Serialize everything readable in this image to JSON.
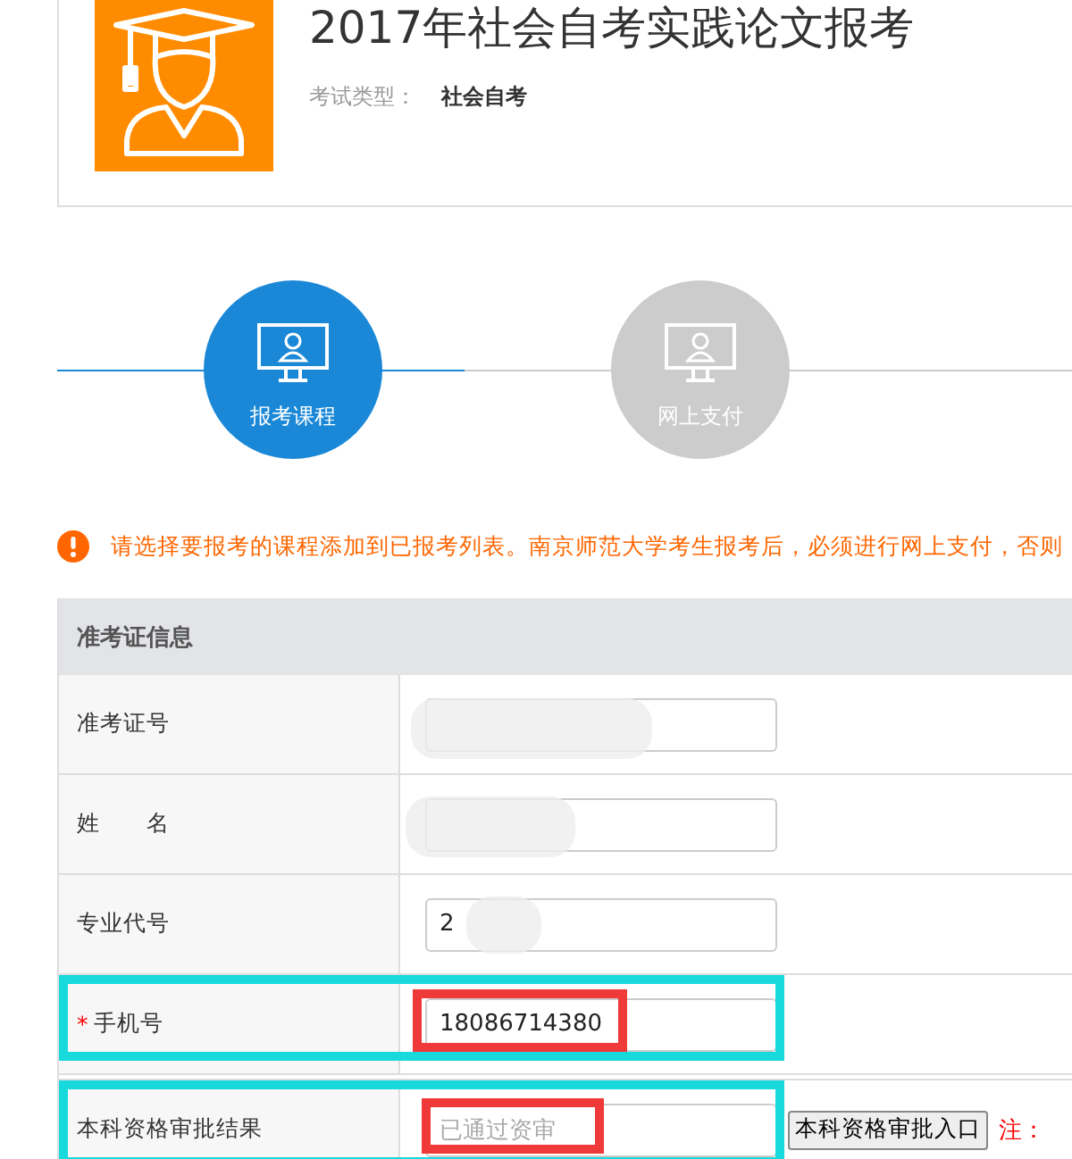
{
  "header": {
    "title": "2017年社会自考实践论文报考",
    "meta_label": "考试类型：",
    "meta_value": "社会自考"
  },
  "steps": [
    {
      "label": "报考课程",
      "selected": true
    },
    {
      "label": "网上支付",
      "selected": false
    }
  ],
  "notice": "请选择要报考的课程添加到已报考列表。南京师范大学考生报考后，必须进行网上支付，否则",
  "form": {
    "title": "准考证信息",
    "rows": [
      {
        "label": "准考证号",
        "redacted": true,
        "highlighted": false,
        "value_highlighted": false
      },
      {
        "label": "姓　　名",
        "redacted": true,
        "highlighted": false,
        "value_highlighted": false
      },
      {
        "label": "专业代号",
        "value": "2",
        "redacted": true,
        "highlighted": false,
        "value_highlighted": false
      },
      {
        "label": "手机号",
        "required_mark": "*",
        "value": "18086714380",
        "redacted": false,
        "highlighted": true,
        "value_highlighted": true
      },
      {
        "label": "本科资格审批结果",
        "placeholder": "已通过资审",
        "redacted": false,
        "highlighted": true,
        "value_highlighted": true,
        "button": "本科资格审批入口",
        "note": "注："
      }
    ]
  }
}
